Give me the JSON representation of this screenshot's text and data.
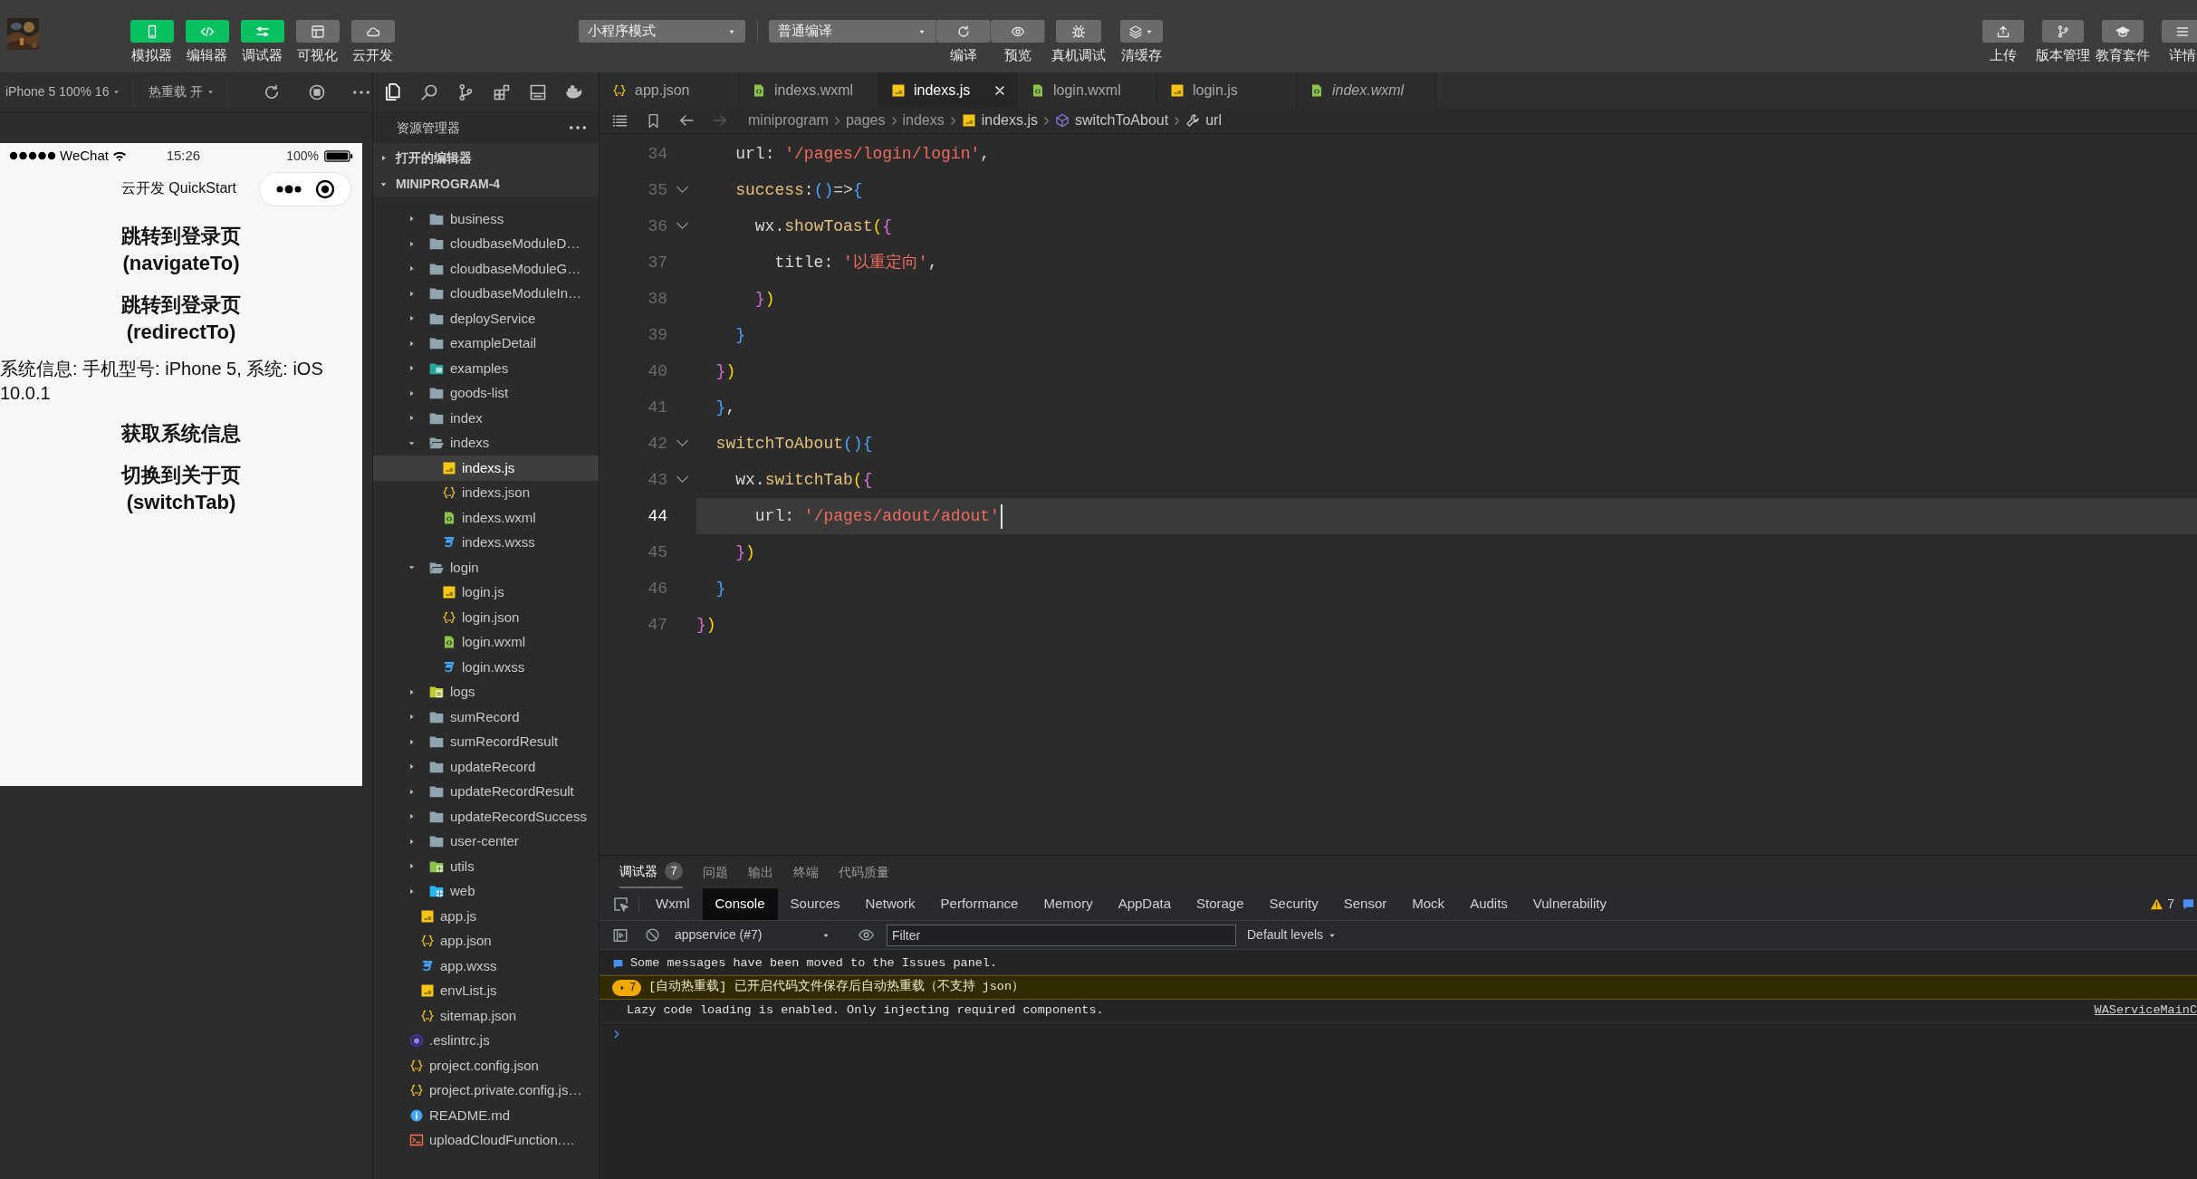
{
  "toolbar": {
    "left": [
      {
        "label": "模拟器",
        "on": true
      },
      {
        "label": "编辑器",
        "on": true
      },
      {
        "label": "调试器",
        "on": true
      },
      {
        "label": "可视化",
        "on": false
      },
      {
        "label": "云开发",
        "on": false
      }
    ],
    "mode_select": {
      "value": "小程序模式"
    },
    "compile_select": {
      "value": "普通编译"
    },
    "compile_actions": [
      {
        "label": "编译"
      },
      {
        "label": "预览"
      }
    ],
    "actions": [
      {
        "label": "真机调试",
        "dropdown": false
      },
      {
        "label": "清缓存",
        "dropdown": true
      }
    ],
    "right": [
      {
        "label": "上传"
      },
      {
        "label": "版本管理"
      },
      {
        "label": "教育套件"
      },
      {
        "label": "详情"
      }
    ]
  },
  "simulator": {
    "device": "iPhone 5 100% 16",
    "hot_reload": "热重载 开",
    "status_bar": {
      "carrier": "WeChat",
      "time": "15:26",
      "battery": "100%"
    },
    "nav_title": "云开发 QuickStart",
    "content": [
      {
        "kind": "button",
        "text": "跳转到登录页(navigateTo)"
      },
      {
        "kind": "button",
        "text": "跳转到登录页(redirectTo)"
      },
      {
        "kind": "text",
        "text": "系统信息: 手机型号: iPhone 5, 系统: iOS 10.0.1"
      },
      {
        "kind": "button",
        "text": "获取系统信息"
      },
      {
        "kind": "button",
        "text": "切换到关于页(switchTab)"
      }
    ]
  },
  "explorer": {
    "title": "资源管理器",
    "sections": [
      {
        "label": "打开的编辑器",
        "expanded": false
      },
      {
        "label": "MINIPROGRAM-4",
        "expanded": true
      }
    ],
    "tree": [
      {
        "children": [
          {
            "children": [
              {
                "label": "business",
                "kind": "folder",
                "expanded": false,
                "selected": false
              },
              {
                "label": "cloudbaseModuleD…",
                "kind": "folder",
                "expanded": false,
                "selected": false
              },
              {
                "label": "cloudbaseModuleG…",
                "kind": "folder",
                "expanded": false,
                "selected": false
              },
              {
                "label": "cloudbaseModuleIn…",
                "kind": "folder",
                "expanded": false,
                "selected": false
              },
              {
                "label": "deployService",
                "kind": "folder",
                "expanded": false,
                "selected": false
              },
              {
                "label": "exampleDetail",
                "kind": "folder",
                "expanded": false,
                "selected": false
              },
              {
                "label": "examples",
                "kind": "folder-image",
                "expanded": false,
                "selected": false
              },
              {
                "label": "goods-list",
                "kind": "folder",
                "expanded": false,
                "selected": false
              },
              {
                "label": "index",
                "kind": "folder",
                "expanded": false,
                "selected": false
              },
              {
                "label": "indexs",
                "kind": "folder",
                "expanded": true,
                "selected": false,
                "children": [
                  {
                    "label": "indexs.js",
                    "kind": "js",
                    "selected": true
                  },
                  {
                    "label": "indexs.json",
                    "kind": "json",
                    "selected": false
                  },
                  {
                    "label": "indexs.wxml",
                    "kind": "wxml",
                    "selected": false
                  },
                  {
                    "label": "indexs.wxss",
                    "kind": "wxss",
                    "selected": false
                  }
                ]
              },
              {
                "label": "login",
                "kind": "folder",
                "expanded": true,
                "selected": false,
                "children": [
                  {
                    "label": "login.js",
                    "kind": "js",
                    "selected": false
                  },
                  {
                    "label": "login.json",
                    "kind": "json",
                    "selected": false
                  },
                  {
                    "label": "login.wxml",
                    "kind": "wxml",
                    "selected": false
                  },
                  {
                    "label": "login.wxss",
                    "kind": "wxss",
                    "selected": false
                  }
                ]
              },
              {
                "label": "logs",
                "kind": "folder-logs",
                "expanded": false,
                "selected": false
              },
              {
                "label": "sumRecord",
                "kind": "folder",
                "expanded": false,
                "selected": false
              },
              {
                "label": "sumRecordResult",
                "kind": "folder",
                "expanded": false,
                "selected": false
              },
              {
                "label": "updateRecord",
                "kind": "folder",
                "expanded": false,
                "selected": false
              },
              {
                "label": "updateRecordResult",
                "kind": "folder",
                "expanded": false,
                "selected": false
              },
              {
                "label": "updateRecordSuccess",
                "kind": "folder",
                "expanded": false,
                "selected": false
              },
              {
                "label": "user-center",
                "kind": "folder",
                "expanded": false,
                "selected": false
              },
              {
                "label": "utils",
                "kind": "folder-utils",
                "expanded": false,
                "selected": false
              },
              {
                "label": "web",
                "kind": "folder-web",
                "expanded": false,
                "selected": false
              }
            ]
          },
          {
            "label": "app.js",
            "kind": "js",
            "selected": false
          },
          {
            "label": "app.json",
            "kind": "json",
            "selected": false
          },
          {
            "label": "app.wxss",
            "kind": "wxss",
            "selected": false
          },
          {
            "label": "envList.js",
            "kind": "js",
            "selected": false
          },
          {
            "label": "sitemap.json",
            "kind": "json",
            "selected": false
          }
        ]
      },
      {
        "label": ".eslintrc.js",
        "kind": "eslint",
        "selected": false
      },
      {
        "label": "project.config.json",
        "kind": "json",
        "selected": false
      },
      {
        "label": "project.private.config.js…",
        "kind": "json",
        "selected": false
      },
      {
        "label": "README.md",
        "kind": "info",
        "selected": false
      },
      {
        "label": "uploadCloudFunction.…",
        "kind": "terminal",
        "selected": false
      }
    ]
  },
  "editor": {
    "tabs": [
      {
        "label": "app.json",
        "kind": "json",
        "selected": false,
        "preview": false
      },
      {
        "label": "indexs.wxml",
        "kind": "wxml",
        "selected": false,
        "preview": false
      },
      {
        "label": "indexs.js",
        "kind": "js",
        "selected": true,
        "preview": false
      },
      {
        "label": "login.wxml",
        "kind": "wxml",
        "selected": false,
        "preview": false
      },
      {
        "label": "login.js",
        "kind": "js",
        "selected": false,
        "preview": false
      },
      {
        "label": "index.wxml",
        "kind": "wxml",
        "selected": false,
        "preview": true
      }
    ],
    "breadcrumb": [
      {
        "label": "miniprogram",
        "kind": "path"
      },
      {
        "label": "pages",
        "kind": "path"
      },
      {
        "label": "indexs",
        "kind": "path"
      },
      {
        "label": "indexs.js",
        "kind": "js"
      },
      {
        "label": "switchToAbout",
        "kind": "method"
      },
      {
        "label": "url",
        "kind": "property"
      }
    ],
    "lines": [
      {
        "number": "34",
        "fold": false,
        "current": false,
        "tokens": [
          {
            "kind": "id",
            "text": "    url"
          },
          {
            "kind": "p",
            "text": ": "
          },
          {
            "kind": "str",
            "text": "'/pages/login/login'"
          },
          {
            "kind": "p",
            "text": ","
          }
        ]
      },
      {
        "number": "35",
        "fold": true,
        "current": false,
        "tokens": [
          {
            "kind": "fn",
            "text": "    success"
          },
          {
            "kind": "p",
            "text": ":"
          },
          {
            "kind": "b3",
            "text": "()"
          },
          {
            "kind": "p",
            "text": "=>"
          },
          {
            "kind": "b3",
            "text": "{"
          }
        ]
      },
      {
        "number": "36",
        "fold": true,
        "current": false,
        "tokens": [
          {
            "kind": "id",
            "text": "      wx"
          },
          {
            "kind": "p",
            "text": "."
          },
          {
            "kind": "fn",
            "text": "showToast"
          },
          {
            "kind": "b1",
            "text": "("
          },
          {
            "kind": "b2",
            "text": "{"
          }
        ]
      },
      {
        "number": "37",
        "fold": false,
        "current": false,
        "tokens": [
          {
            "kind": "id",
            "text": "        title"
          },
          {
            "kind": "p",
            "text": ": "
          },
          {
            "kind": "str",
            "text": "'以重定向'"
          },
          {
            "kind": "p",
            "text": ","
          }
        ]
      },
      {
        "number": "38",
        "fold": false,
        "current": false,
        "tokens": [
          {
            "kind": "b2",
            "text": "      }"
          },
          {
            "kind": "b1",
            "text": ")"
          }
        ]
      },
      {
        "number": "39",
        "fold": false,
        "current": false,
        "tokens": [
          {
            "kind": "b3",
            "text": "    }"
          }
        ]
      },
      {
        "number": "40",
        "fold": false,
        "current": false,
        "tokens": [
          {
            "kind": "b2",
            "text": "  }"
          },
          {
            "kind": "b1",
            "text": ")"
          }
        ]
      },
      {
        "number": "41",
        "fold": false,
        "current": false,
        "tokens": [
          {
            "kind": "b3",
            "text": "  }"
          },
          {
            "kind": "p",
            "text": ","
          }
        ]
      },
      {
        "number": "42",
        "fold": true,
        "current": false,
        "tokens": [
          {
            "kind": "fn",
            "text": "  switchToAbout"
          },
          {
            "kind": "b3",
            "text": "(){"
          }
        ]
      },
      {
        "number": "43",
        "fold": true,
        "current": false,
        "tokens": [
          {
            "kind": "id",
            "text": "    wx"
          },
          {
            "kind": "p",
            "text": "."
          },
          {
            "kind": "fn",
            "text": "switchTab"
          },
          {
            "kind": "b1",
            "text": "("
          },
          {
            "kind": "b2",
            "text": "{"
          }
        ]
      },
      {
        "number": "44",
        "fold": false,
        "current": true,
        "tokens": [
          {
            "kind": "id",
            "text": "      url"
          },
          {
            "kind": "p",
            "text": ": "
          },
          {
            "kind": "str",
            "text": "'/pages/adout/adout'"
          }
        ]
      },
      {
        "number": "45",
        "fold": false,
        "current": false,
        "tokens": [
          {
            "kind": "b2",
            "text": "    }"
          },
          {
            "kind": "b1",
            "text": ")"
          }
        ]
      },
      {
        "number": "46",
        "fold": false,
        "current": false,
        "tokens": [
          {
            "kind": "b3",
            "text": "  }"
          }
        ]
      },
      {
        "number": "47",
        "fold": false,
        "current": false,
        "tokens": [
          {
            "kind": "b2",
            "text": "}"
          },
          {
            "kind": "b1",
            "text": ")"
          }
        ]
      }
    ]
  },
  "panel": {
    "tabs": [
      {
        "label": "调试器",
        "badge": "7",
        "selected": true
      },
      {
        "label": "问题",
        "selected": false
      },
      {
        "label": "输出",
        "selected": false
      },
      {
        "label": "终端",
        "selected": false
      },
      {
        "label": "代码质量",
        "selected": false
      }
    ],
    "devtools_tabs": [
      {
        "label": "Wxml",
        "selected": false
      },
      {
        "label": "Console",
        "selected": true
      },
      {
        "label": "Sources",
        "selected": false
      },
      {
        "label": "Network",
        "selected": false
      },
      {
        "label": "Performance",
        "selected": false
      },
      {
        "label": "Memory",
        "selected": false
      },
      {
        "label": "AppData",
        "selected": false
      },
      {
        "label": "Storage",
        "selected": false
      },
      {
        "label": "Security",
        "selected": false
      },
      {
        "label": "Sensor",
        "selected": false
      },
      {
        "label": "Mock",
        "selected": false
      },
      {
        "label": "Audits",
        "selected": false
      },
      {
        "label": "Vulnerability",
        "selected": false
      }
    ],
    "warning_count": "7",
    "context": "appservice (#7)",
    "filter": {
      "placeholder": "Filter"
    },
    "levels": "Default levels",
    "messages": [
      {
        "kind": "info",
        "text": "Some messages have been moved to the Issues panel."
      },
      {
        "kind": "warning",
        "count": "7",
        "text": "[自动热重载] 已开启代码文件保存后自动热重载（不支持 json）"
      },
      {
        "kind": "log",
        "text": "Lazy code loading is enabled. Only injecting required components.",
        "source": "WAServiceMainC"
      }
    ]
  }
}
